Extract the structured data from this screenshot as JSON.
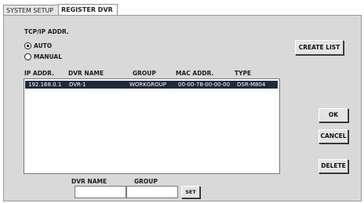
{
  "tabs": [
    {
      "label": "SYSTEM SETUP"
    },
    {
      "label": "REGISTER DVR"
    }
  ],
  "tcpip": {
    "heading": "TCP/IP ADDR.",
    "options": [
      {
        "label": "AUTO",
        "selected": true
      },
      {
        "label": "MANUAL",
        "selected": false
      }
    ]
  },
  "buttons": {
    "create_list": "CREATE LIST",
    "ok": "OK",
    "cancel": "CANCEL",
    "delete": "DELETE",
    "set": "SET"
  },
  "table": {
    "headers": [
      "IP ADDR.",
      "DVR NAME",
      "GROUP",
      "MAC ADDR.",
      "TYPE"
    ],
    "rows": [
      [
        "192.168.0.1",
        "DVR-1",
        "WORKGROUP",
        "00-00-78-00-00-00",
        "DSR-M804"
      ]
    ]
  },
  "edit": {
    "dvr_name_label": "DVR NAME",
    "group_label": "GROUP",
    "dvr_name_value": "",
    "group_value": ""
  },
  "colors": {
    "selection": "#202a3c",
    "panel": "#d9d9d9"
  }
}
